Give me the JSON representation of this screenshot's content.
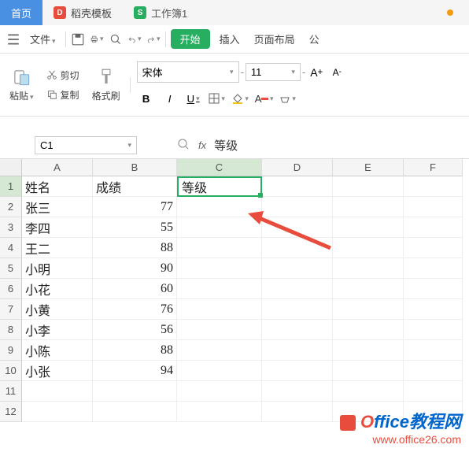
{
  "tabs": {
    "home": "首页",
    "docer": "稻壳模板",
    "doc": "工作簿1"
  },
  "menu": {
    "file": "文件",
    "start": "开始",
    "insert": "插入",
    "layout": "页面布局",
    "publish": "公"
  },
  "toolbar": {
    "paste": "粘贴",
    "cut": "剪切",
    "copy": "复制",
    "formatbrush": "格式刷",
    "font": "宋体",
    "fontsize": "11"
  },
  "namebox": "C1",
  "formula": "等级",
  "cols": [
    "A",
    "B",
    "C",
    "D",
    "E",
    "F"
  ],
  "rows": [
    "1",
    "2",
    "3",
    "4",
    "5",
    "6",
    "7",
    "8",
    "9",
    "10",
    "11",
    "12"
  ],
  "chart_data": {
    "type": "table",
    "headers": [
      "姓名",
      "成绩",
      "等级"
    ],
    "data": [
      {
        "name": "张三",
        "score": 77
      },
      {
        "name": "李四",
        "score": 55
      },
      {
        "name": "王二",
        "score": 88
      },
      {
        "name": "小明",
        "score": 90
      },
      {
        "name": "小花",
        "score": 60
      },
      {
        "name": "小黄",
        "score": 76
      },
      {
        "name": "小李",
        "score": 56
      },
      {
        "name": "小陈",
        "score": 88
      },
      {
        "name": "小张",
        "score": 94
      }
    ]
  },
  "watermark": {
    "line1_a": "O",
    "line1_b": "ffice教程网",
    "line2": "www.office26.com"
  }
}
